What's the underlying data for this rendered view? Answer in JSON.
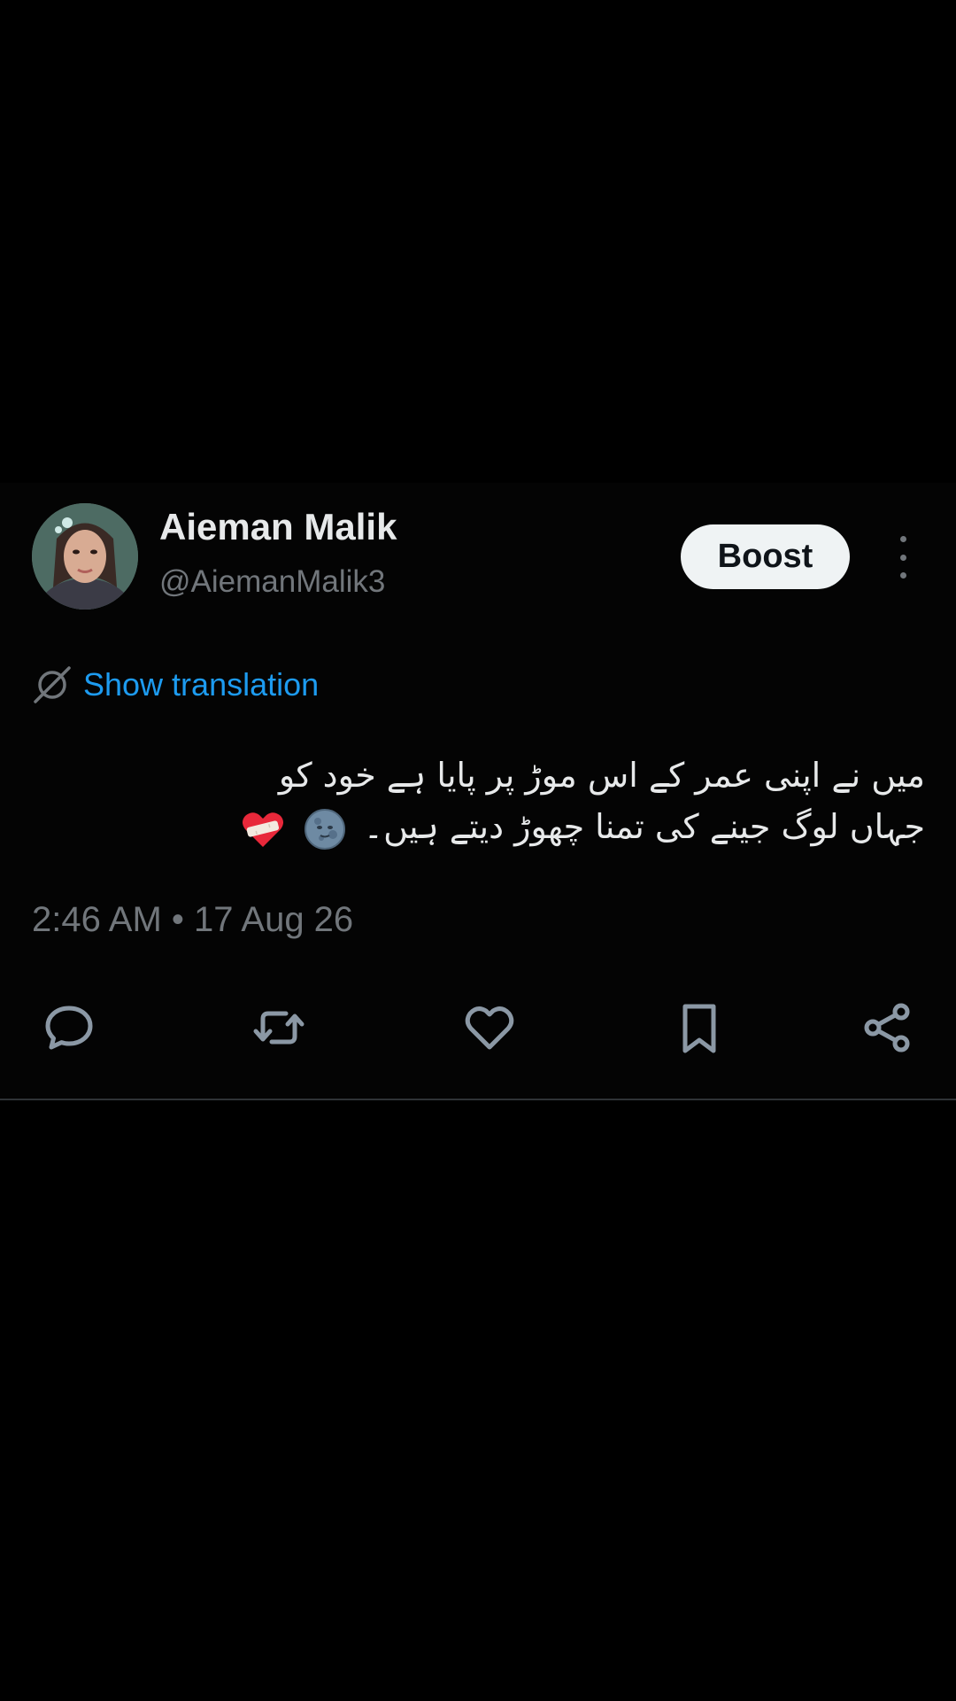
{
  "author": {
    "display_name": "Aieman Malik",
    "handle": "@AiemanMalik3"
  },
  "header": {
    "boost_label": "Boost"
  },
  "translation": {
    "label": "Show translation"
  },
  "tweet": {
    "text_line_1": "میں نے اپنی عمر کے اس موڑ پر پایا ہے خود کو",
    "text_line_2": "جہاں لوگ جینے کی تمنا چھوڑ دیتے ہیں۔",
    "emojis": [
      "new-moon-face-emoji",
      "mending-heart-emoji"
    ],
    "timestamp": "2:46 AM • 17 Aug 26"
  },
  "actions": [
    "reply-icon",
    "repost-icon",
    "like-icon",
    "bookmark-icon",
    "share-icon"
  ],
  "colors": {
    "background": "#000000",
    "text_primary": "#e7e9ea",
    "text_secondary": "#71767b",
    "link_blue": "#1d9bf0",
    "boost_button_bg": "#eff3f4",
    "icon_gray": "#8b98a5"
  }
}
